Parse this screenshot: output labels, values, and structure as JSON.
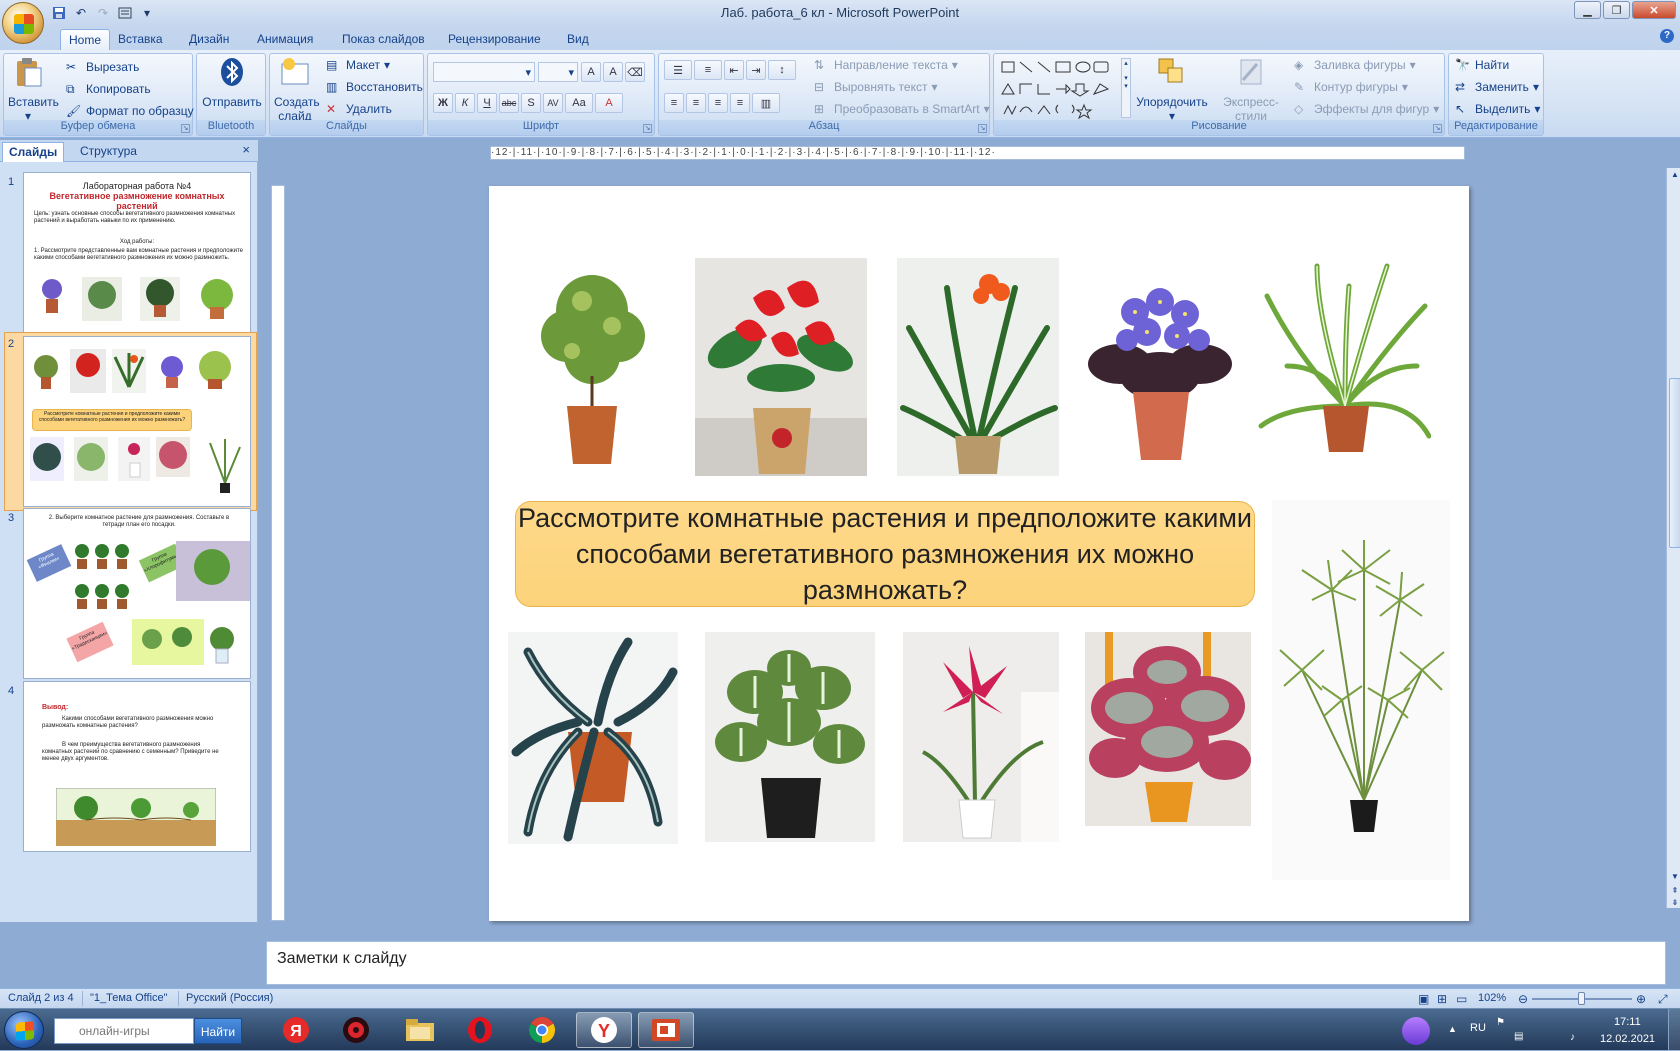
{
  "window": {
    "title": "Лаб. работа_6 кл  -  Microsoft PowerPoint",
    "minimize": "▁",
    "maximize": "❐",
    "close": "✕"
  },
  "qat": [
    "save-icon",
    "undo-icon",
    "redo-icon",
    "print-preview-icon",
    "customize-icon"
  ],
  "tabs": [
    {
      "label": "Home",
      "active": true
    },
    {
      "label": "Вставка"
    },
    {
      "label": "Дизайн"
    },
    {
      "label": "Анимация"
    },
    {
      "label": "Показ слайдов"
    },
    {
      "label": "Рецензирование"
    },
    {
      "label": "Вид"
    }
  ],
  "ribbon": {
    "clipboard": {
      "label": "Буфер обмена",
      "paste": "Вставить",
      "cut": "Вырезать",
      "copy": "Копировать",
      "format_painter": "Формат по образцу"
    },
    "bluetooth": {
      "label": "Bluetooth",
      "send": "Отправить"
    },
    "slides": {
      "label": "Слайды",
      "new_slide": "Создать",
      "new_slide2": "слайд",
      "layout": "Макет",
      "reset": "Восстановить",
      "delete": "Удалить"
    },
    "font": {
      "label": "Шрифт",
      "grow": "A",
      "shrink": "A",
      "bold": "Ж",
      "italic": "К",
      "underline": "Ч",
      "strike": "abc",
      "shadow": "S",
      "spacing": "AV",
      "case": "Aa",
      "color": "A"
    },
    "paragraph": {
      "label": "Абзац",
      "text_direction": "Направление текста",
      "align_text": "Выровнять текст",
      "smartart": "Преобразовать в SmartArt"
    },
    "drawing": {
      "label": "Рисование",
      "arrange": "Упорядочить",
      "quick_styles": "Экспресс-стили",
      "fill": "Заливка фигуры",
      "outline": "Контур фигуры",
      "effects": "Эффекты для фигур"
    },
    "editing": {
      "label": "Редактирование",
      "find": "Найти",
      "replace": "Заменить",
      "select": "Выделить"
    }
  },
  "panel": {
    "tab_slides": "Слайды",
    "tab_outline": "Структура",
    "close": "×",
    "slides": [
      {
        "num": "1",
        "title": "Лабораторная работа №4",
        "subtitle": "Вегетативное размножение комнатных растений",
        "goal": "Цель: узнать основные способы вегетативного размножения комнатных растений и выработать навыки по их применению.",
        "progress_title": "Ход работы:",
        "step": "1.  Рассмотрите представленные вам комнатные растения и предположите какими способами вегетативного размножения их можно размножить."
      },
      {
        "num": "2",
        "callout": "Рассмотрите комнатные растения и предположите какими способами вегетативного размножения их можно размножать?"
      },
      {
        "num": "3",
        "title": "2. Выберите комнатное растение для размножения. Составьте в тетради план его посадки.",
        "label1": "Группа «Фиалки»",
        "label2": "Группа «Хлорофитумы»",
        "label3": "Группа «Традесканции»"
      },
      {
        "num": "4",
        "title": "Вывод:",
        "q1": "Какими способами вегетативного размножения можно размножать комнатные растения?",
        "q2": "В чем преимущества вегетативного размножения комнатных растений по сравнению с семенным? Приведите не менее двух аргументов."
      }
    ]
  },
  "ruler": {
    "horizontal": "·12·|·11·|·10·|·9·|·8·|·7·|·6·|·5·|·4·|·3·|·2·|·1·|·0·|·1·|·2·|·3·|·4·|·5·|·6·|·7·|·8·|·9·|·10·|·11·|·12·"
  },
  "slide": {
    "callout": "Рассмотрите комнатные растения и предположите какими способами вегетативного размножения их можно размножать?",
    "plants": [
      "ficus",
      "anthurium",
      "clivia",
      "violet",
      "chlorophytum",
      "tradescantia",
      "syngonium",
      "amaryllis",
      "begonia",
      "cyperus"
    ]
  },
  "notes": {
    "placeholder": "Заметки к слайду"
  },
  "status": {
    "slide": "Слайд 2 из 4",
    "theme": "\"1_Тема Office\"",
    "language": "Русский (Россия)",
    "zoom": "102%",
    "zoom_level": 0.5
  },
  "taskbar": {
    "search_placeholder": "онлайн-игры",
    "search_button": "Найти",
    "lang": "RU",
    "time": "17:11",
    "date": "12.02.2021",
    "apps": [
      "yandex-icon",
      "game-icon",
      "explorer-icon",
      "opera-icon",
      "chrome-icon",
      "yandex-browser-icon",
      "powerpoint-icon"
    ]
  }
}
